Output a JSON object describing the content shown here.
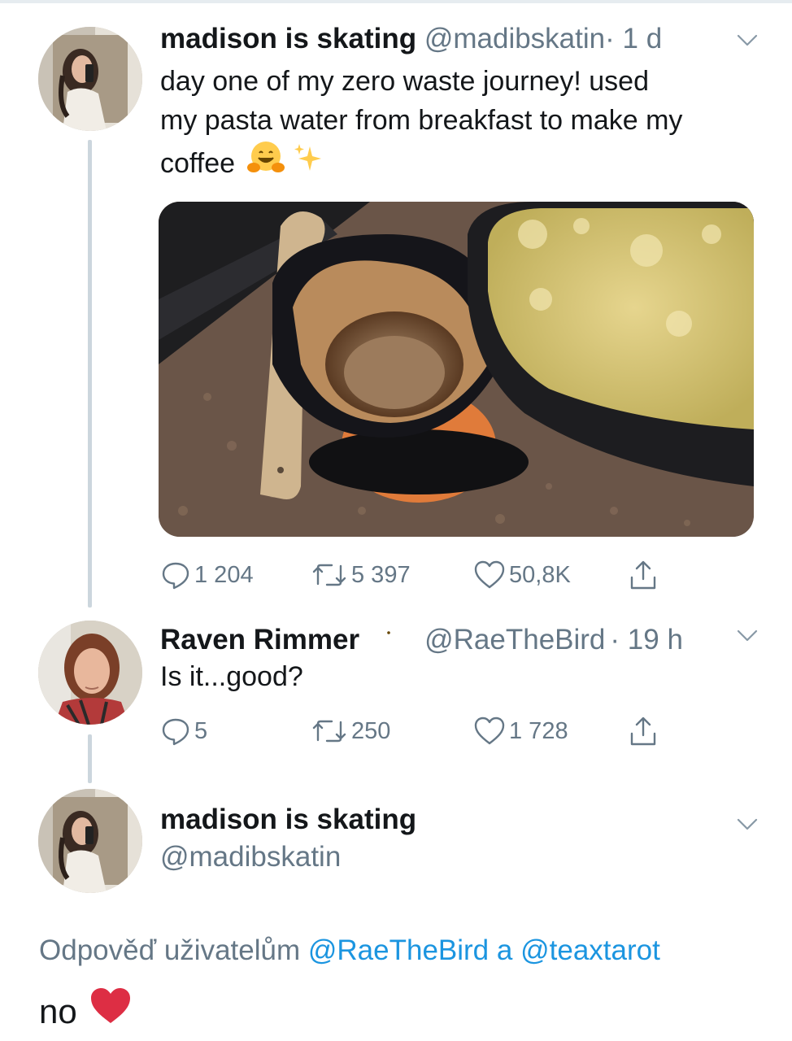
{
  "tweets": [
    {
      "display_name": "madison is skating",
      "handle": "@madibskatin",
      "time": "· 1 d",
      "text_lines": [
        "day one of my zero waste journey! used",
        "my pasta water from breakfast to make my",
        "coffee"
      ],
      "replies": "1 204",
      "retweets": "5 397",
      "likes": "50,8K"
    },
    {
      "display_name": "Raven Rimmer",
      "handle": "@RaeTheBird",
      "time": "· 19 h",
      "text": "Is it...good?",
      "replies": "5",
      "retweets": "250",
      "likes": "1 728"
    },
    {
      "display_name": "madison is skating",
      "handle": "@madibskatin",
      "reply_prefix": "Odpověď uživatelům",
      "reply_mention_1": "@RaeTheBird",
      "reply_joiner": "a",
      "reply_mention_2": "@teaxtarot",
      "text": "no"
    }
  ],
  "colors": {
    "link": "#1b95e0",
    "secondary_text": "#657786",
    "thread_line": "#ccd6dd",
    "heart": "#e0245e"
  },
  "icons": [
    "reply-icon",
    "retweet-icon",
    "like-icon",
    "share-icon",
    "chevron-down-icon",
    "hugging-face-emoji",
    "sparkles-emoji",
    "crescent-moon-emoji",
    "red-heart-emoji"
  ]
}
